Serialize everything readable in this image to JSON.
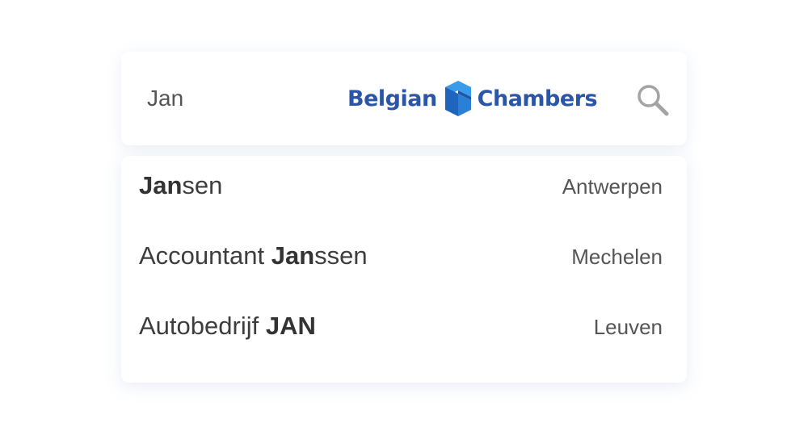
{
  "search": {
    "query": "Jan"
  },
  "logo": {
    "word_left": "Belgian",
    "word_right": "Chambers",
    "color": "#2b55a6",
    "mark_color_light": "#2f8fe0",
    "mark_color_dark": "#1d5fb8"
  },
  "icons": {
    "search": "search-icon",
    "logo_mark": "cube-logo-icon"
  },
  "results": [
    {
      "match": "Jan",
      "rest": "sen",
      "prefix": "",
      "city": "Antwerpen"
    },
    {
      "prefix": "Accountant ",
      "match": "Jan",
      "rest": "ssen",
      "city": "Mechelen"
    },
    {
      "prefix": "Autobedrijf ",
      "match": "JAN",
      "rest": "",
      "city": "Leuven"
    }
  ]
}
